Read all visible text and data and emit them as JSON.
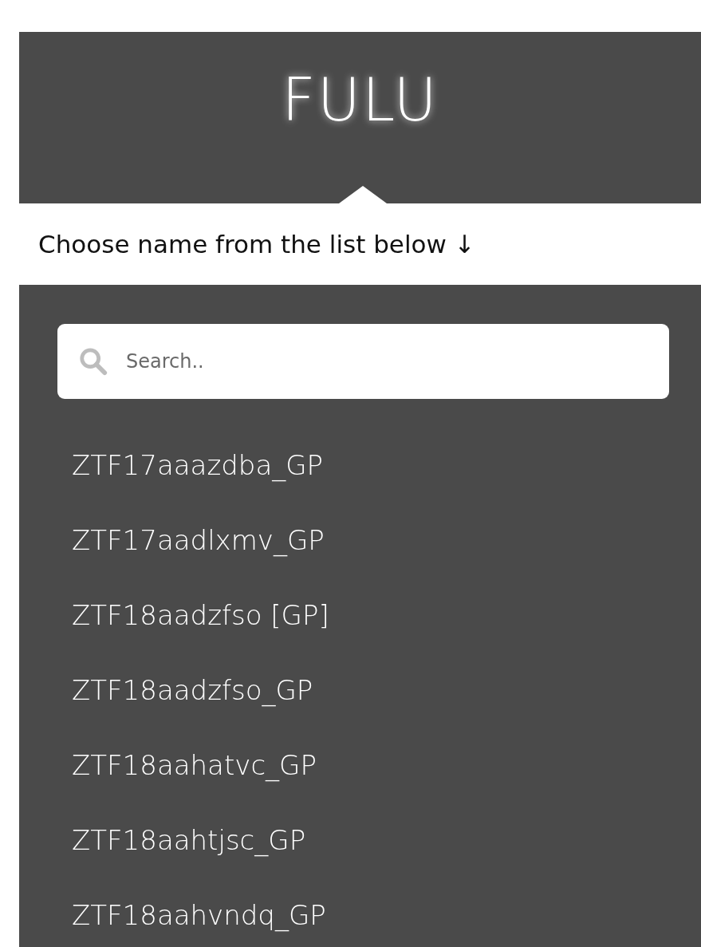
{
  "header": {
    "logo": "FULU"
  },
  "prompt": {
    "text": "Choose name from the list below ↓"
  },
  "search": {
    "placeholder": "Search.."
  },
  "names": [
    "ZTF17aaazdba_GP",
    "ZTF17aadlxmv_GP",
    "ZTF18aadzfso [GP]",
    "ZTF18aadzfso_GP",
    "ZTF18aahatvc_GP",
    "ZTF18aahtjsc_GP",
    "ZTF18aahvndq_GP"
  ]
}
